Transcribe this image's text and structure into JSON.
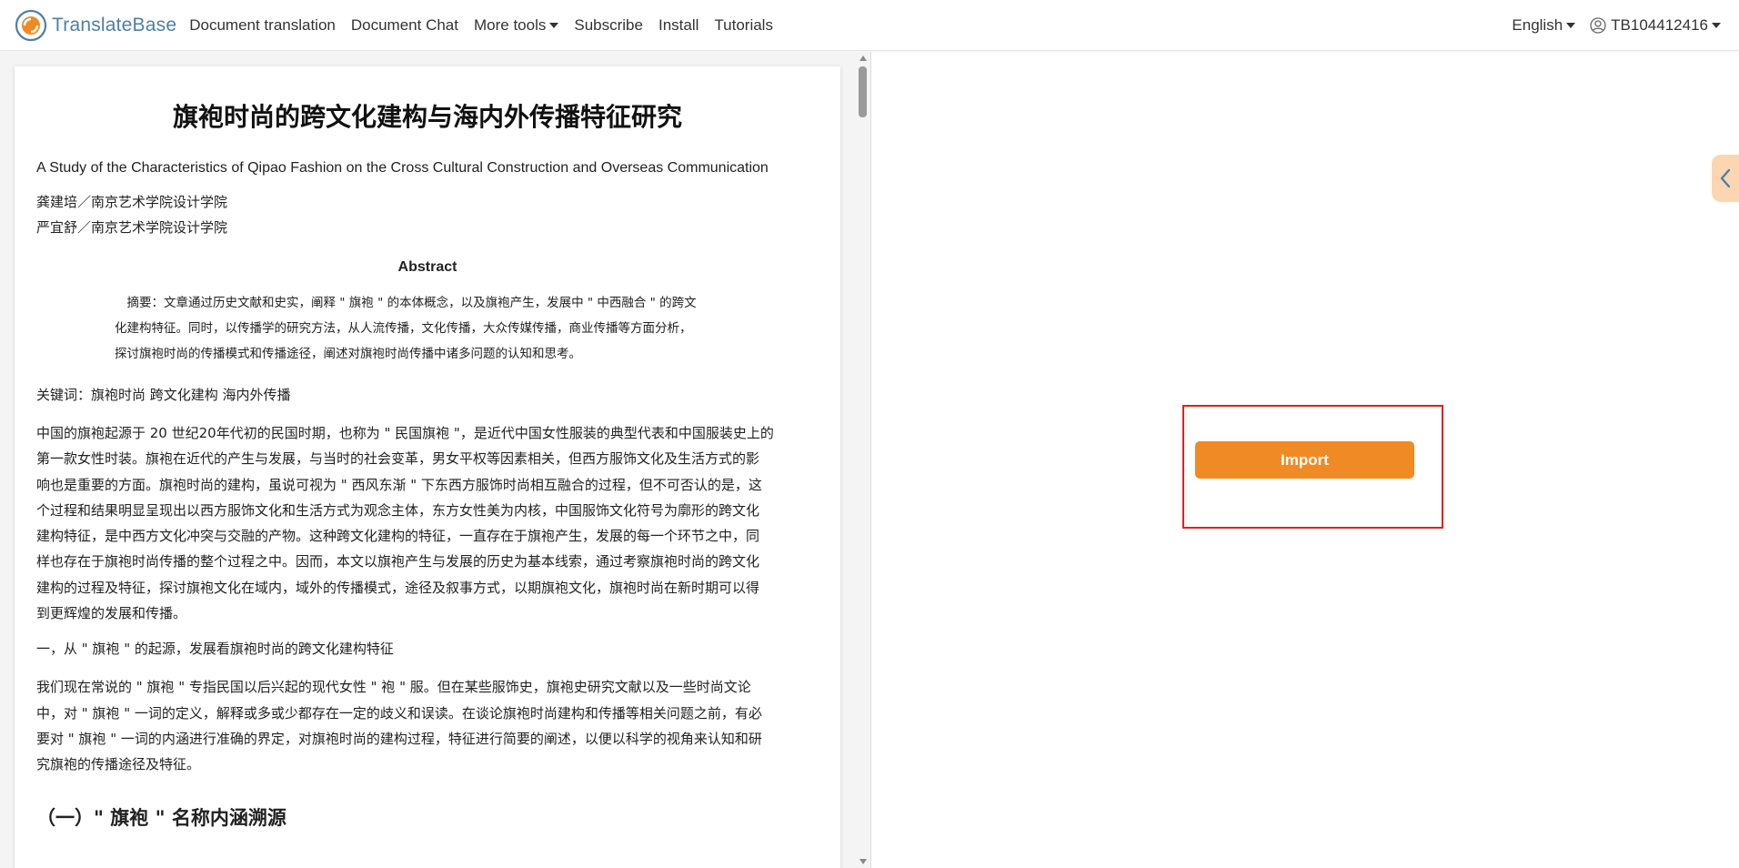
{
  "header": {
    "brand": "TranslateBase",
    "nav": [
      {
        "label": "Document translation"
      },
      {
        "label": "Document Chat"
      },
      {
        "label": "More tools",
        "dropdown": true
      },
      {
        "label": "Subscribe"
      },
      {
        "label": "Install"
      },
      {
        "label": "Tutorials"
      }
    ],
    "language": "English",
    "user_id": "TB104412416"
  },
  "document": {
    "title": "旗袍时尚的跨文化建构与海内外传播特征研究",
    "subtitle": "A Study of the Characteristics of Qipao Fashion on the Cross Cultural Construction and Overseas Communication",
    "authors": [
      "龚建培／南京艺术学院设计学院",
      "严宜舒／南京艺术学院设计学院"
    ],
    "abstract_heading": "Abstract",
    "abstract_lines": [
      "　摘要：文章通过历史文献和史实，阐释 \" 旗袍 \" 的本体概念，以及旗袍产生，发展中 \" 中西融合 \" 的跨文",
      "化建构特征。同时，以传播学的研究方法，从人流传播，文化传播，大众传媒传播，商业传播等方面分析，",
      "探讨旗袍时尚的传播模式和传播途径，阐述对旗袍时尚传播中诸多问题的认知和思考。"
    ],
    "keywords": "关键词：旗袍时尚 跨文化建构 海内外传播",
    "para1_lines": [
      "中国的旗袍起源于 20 世纪20年代初的民国时期，也称为 \" 民国旗袍 \"，是近代中国女性服装的典型代表和中国服装史上的",
      "第一款女性时装。旗袍在近代的产生与发展，与当时的社会变革，男女平权等因素相关，但西方服饰文化及生活方式的影",
      "响也是重要的方面。旗袍时尚的建构，虽说可视为 \" 西风东渐 \" 下东西方服饰时尚相互融合的过程，但不可否认的是，这",
      "个过程和结果明显呈现出以西方服饰文化和生活方式为观念主体，东方女性美为内核，中国服饰文化符号为廓形的跨文化",
      "建构特征，是中西方文化冲突与交融的产物。这种跨文化建构的特征，一直存在于旗袍产生，发展的每一个环节之中，同",
      "样也存在于旗袍时尚传播的整个过程之中。因而，本文以旗袍产生与发展的历史为基本线索，通过考察旗袍时尚的跨文化",
      "建构的过程及特征，探讨旗袍文化在域内，域外的传播模式，途径及叙事方式，以期旗袍文化，旗袍时尚在新时期可以得",
      "到更辉煌的发展和传播。"
    ],
    "section1": "一，从 \" 旗袍 \" 的起源，发展看旗袍时尚的跨文化建构特征",
    "para2_lines": [
      "我们现在常说的 \" 旗袍 \" 专指民国以后兴起的现代女性 \" 袍 \" 服。但在某些服饰史，旗袍史研究文献以及一些时尚文论",
      "中，对 \" 旗袍 \" 一词的定义，解释或多或少都存在一定的歧义和误读。在谈论旗袍时尚建构和传播等相关问题之前，有必",
      "要对 \" 旗袍 \" 一词的内涵进行准确的界定，对旗袍时尚的建构过程，特征进行简要的阐述，以便以科学的视角来认知和研",
      "究旗袍的传播途径及特征。"
    ],
    "subheading": "（一）\" 旗袍 \" 名称内涵溯源"
  },
  "import": {
    "label": "Import"
  },
  "colors": {
    "brand": "#4d7fa8",
    "accent": "#f08a24",
    "highlight": "#e02020",
    "side_tab": "#fcd6b0"
  },
  "icons": {
    "logo": "translatebase-logo-icon",
    "user": "user-circle-icon",
    "side_tab": "chevron-left-icon"
  }
}
